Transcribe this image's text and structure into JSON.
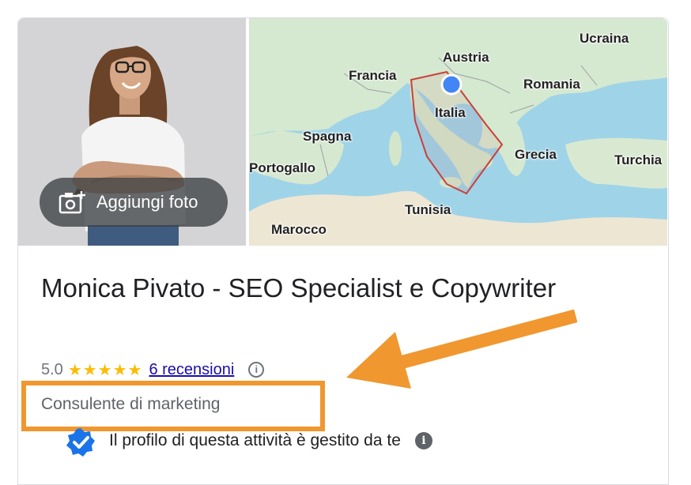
{
  "photo": {
    "add_photo_label": "Aggiungi foto",
    "icon": "add-photo-icon"
  },
  "map": {
    "labels": {
      "austria": "Austria",
      "ucraina": "Ucraina",
      "francia": "Francia",
      "romania": "Romania",
      "italia": "Italia",
      "spagna": "Spagna",
      "grecia": "Grecia",
      "portogallo": "Portogallo",
      "turchia": "Turchia",
      "tunisia": "Tunisia",
      "marocco": "Marocco"
    },
    "colors": {
      "sea": "#9fd3e8",
      "land": "#d9ead7",
      "area_outline": "#c9413c",
      "location_dot": "#4285f4"
    }
  },
  "business": {
    "name": "Monica Pivato - SEO Specialist e Copywriter",
    "rating_value": "5.0",
    "stars": "★★★★★",
    "reviews_label": "6 recensioni",
    "category": "Consulente di marketing",
    "managed_text": "Il profilo di questa attività è gestito da te"
  },
  "annotation": {
    "highlight_color": "#f0972f"
  }
}
